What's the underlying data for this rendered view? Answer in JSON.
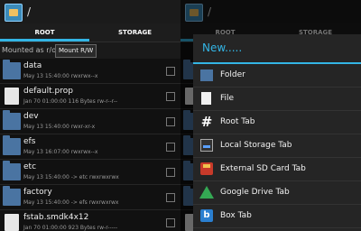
{
  "app": {
    "path": "/"
  },
  "tabs": [
    {
      "label": "ROOT"
    },
    {
      "label": "STORAGE"
    }
  ],
  "mount": {
    "status": "Mounted as r/o",
    "button": "Mount R/W"
  },
  "files": [
    {
      "name": "data",
      "meta": "May 13 15:40:00   rwxrwx--x",
      "type": "folder"
    },
    {
      "name": "default.prop",
      "meta": "Jan 70 01:00:00  116 Bytes  rw-r--r--",
      "type": "file"
    },
    {
      "name": "dev",
      "meta": "May 13 15:40:00   rwxr-xr-x",
      "type": "folder"
    },
    {
      "name": "efs",
      "meta": "May 13 16:07:00   rwxrwx--x",
      "type": "folder"
    },
    {
      "name": "etc",
      "meta": "May 13 15:40:00   -> etc  rwxrwxrwx",
      "type": "folder"
    },
    {
      "name": "factory",
      "meta": "May 13 15:40:00   -> efs  rwxrwxrwx",
      "type": "folder"
    },
    {
      "name": "fstab.smdk4x12",
      "meta": "Jan 70 01:00:00  923 Bytes  rw-r-----",
      "type": "file"
    }
  ],
  "menu": {
    "title": "New.....",
    "items": [
      {
        "label": "Folder",
        "icon": "folder-icon"
      },
      {
        "label": "File",
        "icon": "file-icon"
      },
      {
        "label": "Root Tab",
        "icon": "hash-icon"
      },
      {
        "label": "Local Storage Tab",
        "icon": "local-storage-icon"
      },
      {
        "label": "External SD Card Tab",
        "icon": "sd-card-icon"
      },
      {
        "label": "Google Drive Tab",
        "icon": "google-drive-icon"
      },
      {
        "label": "Box Tab",
        "icon": "box-icon"
      }
    ]
  },
  "colors": {
    "accent": "#33b5e5",
    "folder": "#4a74a2"
  }
}
